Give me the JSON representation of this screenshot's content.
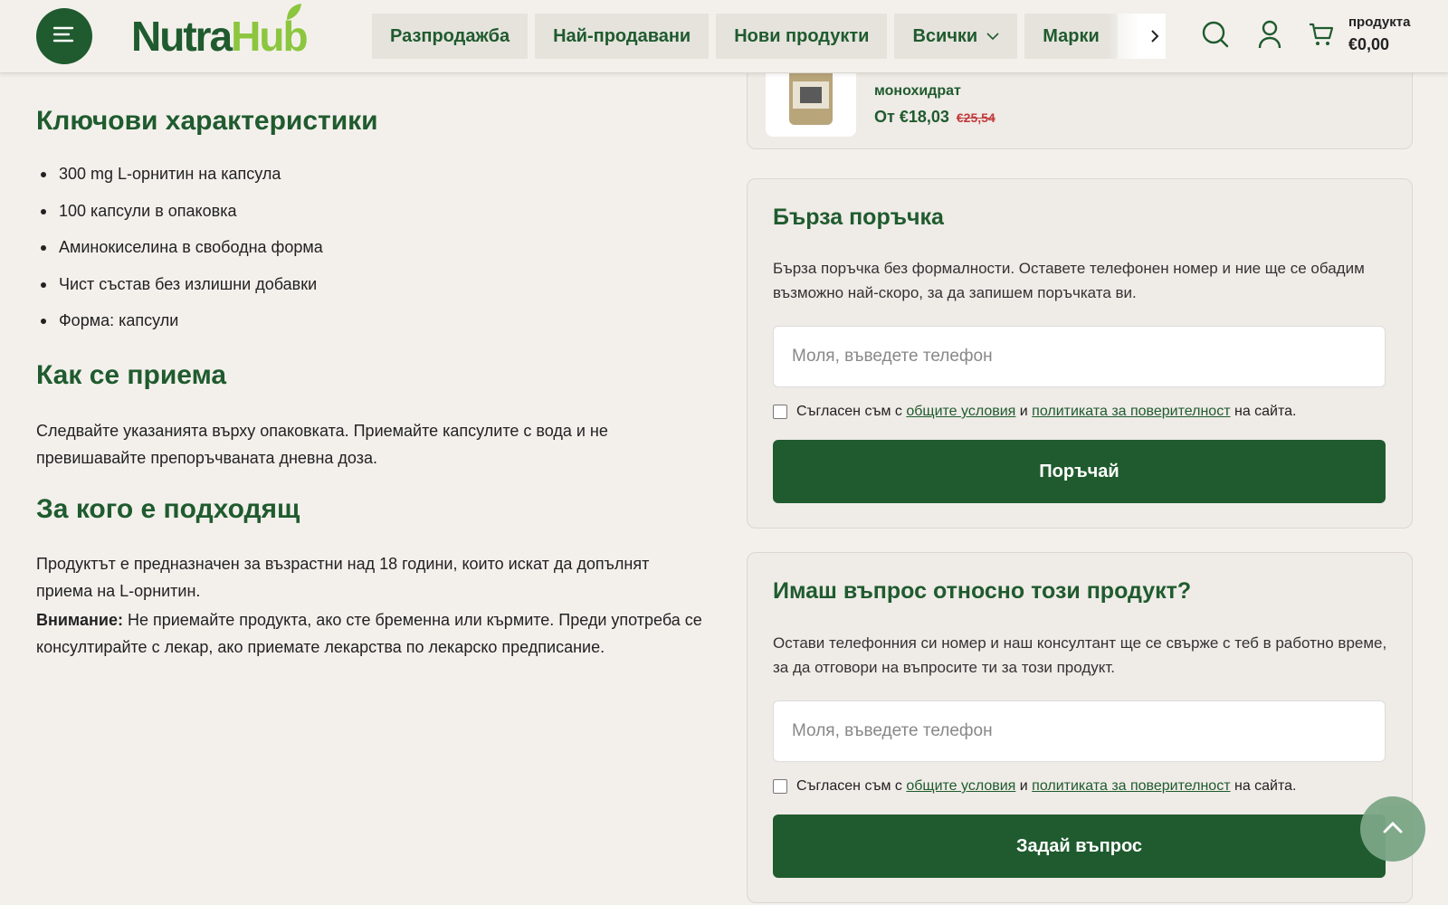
{
  "header": {
    "logo_part1": "Nutra",
    "logo_part2": "Hub",
    "nav": [
      {
        "label": "Разпродажба"
      },
      {
        "label": "Най-продавани"
      },
      {
        "label": "Нови продукти"
      },
      {
        "label": "Всички"
      },
      {
        "label": "Марки"
      }
    ],
    "cart_label": "продукта",
    "cart_total": "€0,00"
  },
  "left": {
    "features_title": "Ключови характеристики",
    "features": [
      "300 mg L-орнитин на капсула",
      "100 капсули в опаковка",
      "Аминокиселина в свободна форма",
      "Чист състав без излишни добавки",
      "Форма: капсули"
    ],
    "usage_title": "Как се приема",
    "usage_text": "Следвайте указанията върху опаковката. Приемайте капсулите с вода и не превишавайте препоръчваната дневна доза.",
    "audience_title": "За кого е подходящ",
    "audience_text": "Продуктът е предназначен за възрастни над 18 години, които искат да допълнят приема на L-орнитин.",
    "warning_label": "Внимание:",
    "warning_text": " Не приемайте продукта, ако сте бременна или кърмите. Преди употреба се консултирайте с лекар, ако приемате лекарства по лекарско предписание."
  },
  "related": {
    "name": "монохидрат",
    "price": "От €18,03",
    "old_price": "€25,54"
  },
  "quick_order": {
    "title": "Бърза поръчка",
    "desc": "Бърза поръчка без формалности. Оставете телефонен номер и ние ще се обадим възможно най-скоро, за да запишем поръчката ви.",
    "placeholder": "Моля, въведете телефон",
    "agree_prefix": "Съгласен съм с ",
    "terms_link": "общите условия",
    "and": " и ",
    "privacy_link": "политиката за поверителност",
    "agree_suffix": " на сайта.",
    "button": "Поръчай"
  },
  "question": {
    "title": "Имаш въпрос относно този продукт?",
    "desc": "Остави телефонния си номер и наш консултант ще се свърже с теб в работно време, за да отговори на въпросите ти за този продукт.",
    "placeholder": "Моля, въведете телефон",
    "agree_prefix": "Съгласен съм с ",
    "terms_link": "общите условия",
    "and": " и ",
    "privacy_link": "политиката за поверителност",
    "agree_suffix": " на сайта.",
    "button": "Задай въпрос"
  },
  "colors": {
    "brand_green": "#1f5b2e",
    "logo_lime": "#8cc63f",
    "background": "#f3f0ec",
    "old_price_red": "#c23b3b"
  },
  "icons": [
    "menu-icon",
    "search-icon",
    "user-icon",
    "cart-icon",
    "chevron-down-icon",
    "chevron-right-icon",
    "chevron-up-icon"
  ]
}
